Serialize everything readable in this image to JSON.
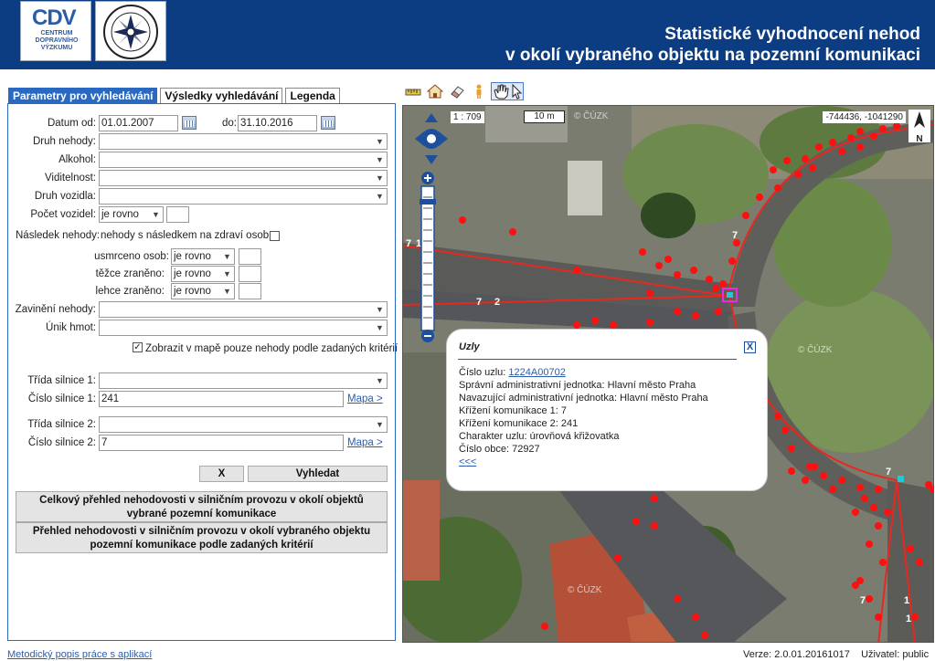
{
  "header": {
    "cdv_logo_mark": "CDV",
    "cdv_logo_text": "CENTRUM DOPRAVNÍHO VÝZKUMU",
    "police_logo_text": "POLICIE ČESKÉ REPUBLIKY",
    "title_line1": "Statistické vyhodnocení nehod",
    "title_line2": "v okolí vybraného objektu na pozemní komunikaci",
    "colors": {
      "header_bg": "#0c3c82",
      "accent": "#2a69c1"
    }
  },
  "tabs": [
    {
      "label": "Parametry pro vyhledávání",
      "active": true
    },
    {
      "label": "Výsledky vyhledávání",
      "active": false
    },
    {
      "label": "Legenda",
      "active": false
    }
  ],
  "form": {
    "date_from_label": "Datum od:",
    "date_from_value": "01.01.2007",
    "date_to_label": "do:",
    "date_to_value": "31.10.2016",
    "druh_nehody_label": "Druh nehody:",
    "alkohol_label": "Alkohol:",
    "viditelnost_label": "Viditelnost:",
    "druh_vozidla_label": "Druh vozidla:",
    "pocet_vozidel_label": "Počet vozidel:",
    "pocet_vozidel_op": "je rovno",
    "nasledek_label": "Následek nehody:",
    "nasledek_check_label": "nehody s následkem na zdraví osob",
    "usmrceno_label": "usmrceno osob:",
    "usmrceno_op": "je rovno",
    "tezce_label": "těžce zraněno:",
    "tezce_op": "je rovno",
    "lehce_label": "lehce zraněno:",
    "lehce_op": "je rovno",
    "zavineni_label": "Zavinění nehody:",
    "unik_label": "Únik hmot:",
    "zobrazit_check": "✓",
    "zobrazit_label": "Zobrazit v mapě pouze nehody podle zadaných kritérií",
    "trida1_label": "Třída silnice 1:",
    "cislo1_label": "Číslo silnice 1:",
    "cislo1_value": "241",
    "mapa1_link": "Mapa >",
    "trida2_label": "Třída silnice 2:",
    "cislo2_label": "Číslo silnice 2:",
    "cislo2_value": "7",
    "mapa2_link": "Mapa >",
    "clear_button": "X",
    "search_button": "Vyhledat",
    "overview_button": "Celkový přehled nehodovosti v silničním provozu v okolí objektů vybrané pozemní komunikace",
    "criteria_button": "Přehled nehodovosti v silničním provozu v okolí vybraného objektu pozemní komunikace podle zadaných kritérií"
  },
  "map": {
    "scale_ratio": "1 : 709",
    "scale_bar": "10 m",
    "coordinates": "-744436, -1041290",
    "north_label": "N",
    "copyright": "© ČÚZK",
    "road_labels": [
      "7",
      "1",
      "7",
      "2",
      "7",
      "7",
      "1",
      "7",
      "1"
    ],
    "accident_color": "#ff0000",
    "road_color": "#e8281f"
  },
  "popup": {
    "title": "Uzly",
    "close": "X",
    "node_label": "Číslo uzlu:",
    "node_value": "1224A00702",
    "admin_unit": "Správní administrativní jednotka: Hlavní město Praha",
    "next_admin_unit": "Navazující administrativní jednotka: Hlavní město Praha",
    "crossing1": "Křížení komunikace 1: 7",
    "crossing2": "Křížení komunikace 2: 241",
    "character": "Charakter uzlu: úrovňová křižovatka",
    "municipality": "Číslo obce: 72927",
    "back_link": "<<<"
  },
  "footer": {
    "help_link": "Metodický popis práce s aplikací",
    "version_label": "Verze:",
    "version_value": "2.0.01.20161017",
    "user_label": "Uživatel:",
    "user_value": "public"
  }
}
